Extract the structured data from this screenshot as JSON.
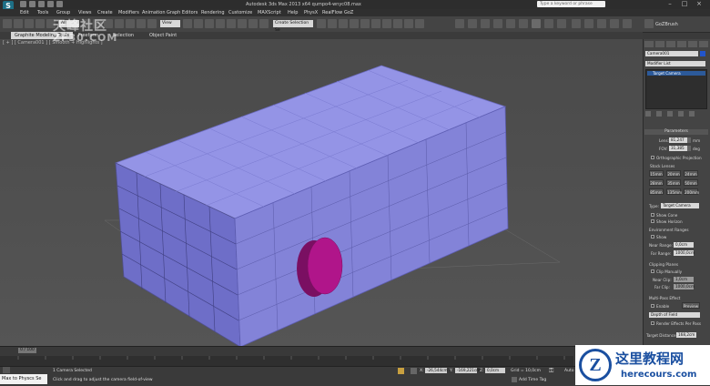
{
  "titlebar": {
    "logo": "S",
    "title": "Autodesk 3ds Max 2013 x64    qumpo4-wnyc08.max",
    "search_placeholder": "Type a keyword or phrase"
  },
  "menus": [
    "Edit",
    "Tools",
    "Group",
    "Views",
    "Create",
    "Modifiers",
    "Animation",
    "Graph Editors",
    "Rendering",
    "Customize",
    "MAXScript",
    "Help",
    "PhysX",
    "RealFlow",
    "GoZ"
  ],
  "toolbar": {
    "selection_filter": "All",
    "view_dropdown": "View",
    "named_sets": "Create Selection Se",
    "gozbrush_label": "GoZBrush"
  },
  "ribbon": {
    "tabs": [
      "Graphite Modeling Tools",
      "Freeform",
      "Selection",
      "Object Paint"
    ],
    "active": "Graphite Modeling Tools"
  },
  "viewport": {
    "label": "[ + ] [ Camera001 ] [ Smooth + Highlights ]",
    "box_color": "#8f8fe0",
    "cylinder_color": "#b0158a"
  },
  "panel": {
    "object_name": "Camera001",
    "modifier_list": "Modifier List",
    "stack_item": "Target Camera",
    "parameters_title": "Parameters",
    "lens_label": "Lens:",
    "lens_value": "81,247",
    "lens_unit": "mm",
    "fov_label": "FOV:",
    "fov_value": "31,385",
    "fov_unit": "deg",
    "ortho_label": "Orthographic Projection",
    "stock_lenses_title": "Stock Lenses",
    "stock_lenses": [
      "15mm",
      "20mm",
      "24mm",
      "28mm",
      "35mm",
      "50mm",
      "85mm",
      "135mm",
      "200mm"
    ],
    "type_label": "Type:",
    "type_value": "Target Camera",
    "show_cone": "Show Cone",
    "show_horizon": "Show Horizon",
    "env_ranges_title": "Environment Ranges",
    "env_show": "Show",
    "near_range_label": "Near Range:",
    "near_range_value": "0,0cm",
    "far_range_label": "Far Range:",
    "far_range_value": "1000,0cm",
    "clipping_title": "Clipping Planes",
    "clip_manually": "Clip Manually",
    "near_clip_label": "Near Clip:",
    "near_clip_value": "1,0cm",
    "far_clip_label": "Far Clip:",
    "far_clip_value": "1000,0cm",
    "multipass_title": "Multi-Pass Effect",
    "enable_label": "Enable",
    "preview_label": "Preview",
    "effect_value": "Depth of Field",
    "render_effects": "Render Effects Per Pass",
    "target_distance_label": "Target Distance:",
    "target_distance_value": "168,2cm"
  },
  "timeline": {
    "slider": "0 / 100"
  },
  "status": {
    "maxscript": "Max to Physcs Se",
    "selected": "1 Camera Selected",
    "hint": "Click and drag to adjust the camera field-of-view",
    "x_label": "X:",
    "x_value": "-26,544cm",
    "y_label": "Y:",
    "y_value": "-169,221cm",
    "z_label": "Z:",
    "z_value": "0,0cm",
    "grid": "Grid = 10,0cm",
    "auto": "Auto",
    "add_time_tag": "Add Time Tag"
  },
  "watermarks": {
    "left_line1": "天峰社区",
    "left_line2": "ZF30.COM",
    "right_line1": "这里教程网",
    "right_line2": "herecours.com"
  }
}
